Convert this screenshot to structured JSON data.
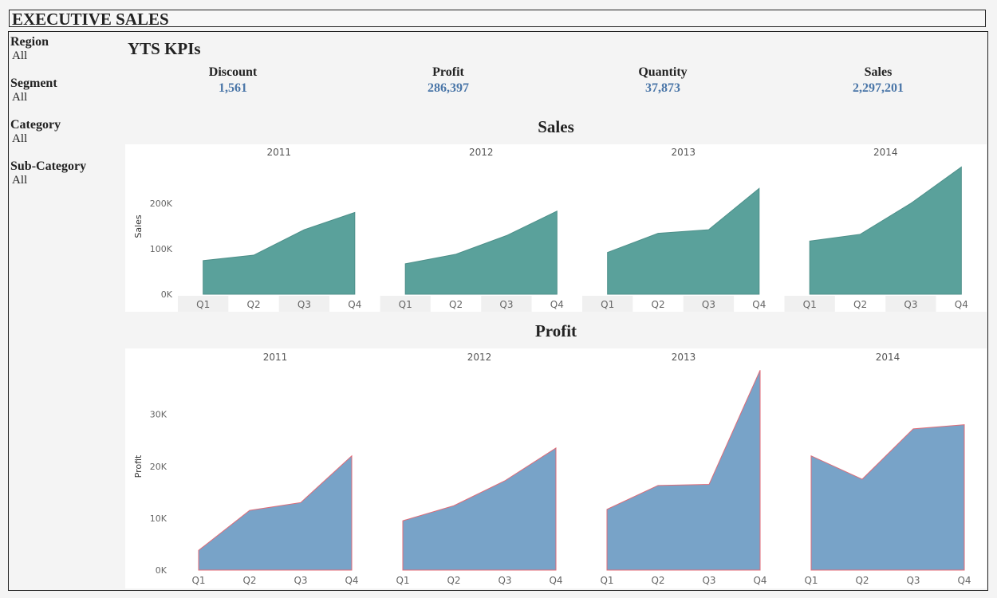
{
  "header": {
    "title": "EXECUTIVE SALES"
  },
  "filters": [
    {
      "label": "Region",
      "value": "All"
    },
    {
      "label": "Segment",
      "value": "All"
    },
    {
      "label": "Category",
      "value": "All"
    },
    {
      "label": "Sub-Category",
      "value": "All"
    }
  ],
  "kpis": {
    "title": "YTS KPIs",
    "items": [
      {
        "label": "Discount",
        "value": "1,561"
      },
      {
        "label": "Profit",
        "value": "286,397"
      },
      {
        "label": "Quantity",
        "value": "37,873"
      },
      {
        "label": "Sales",
        "value": "2,297,201"
      }
    ]
  },
  "colors": {
    "kpi_value": "#4a76a8",
    "sales_fill": "#5aa19b",
    "profit_fill": "#78a3c8",
    "profit_stroke": "#e06b77"
  },
  "chart_data": [
    {
      "type": "area",
      "title": "Sales",
      "ylabel": "Sales",
      "xlabel": "",
      "ylim": [
        0,
        230000
      ],
      "yticks": [
        0,
        100000,
        200000
      ],
      "ytick_labels": [
        "0K",
        "100K",
        "200K"
      ],
      "panels": [
        "2011",
        "2012",
        "2013",
        "2014"
      ],
      "x": [
        "Q1",
        "Q2",
        "Q3",
        "Q4"
      ],
      "values": [
        [
          74000,
          86000,
          142000,
          180000
        ],
        [
          67000,
          88000,
          129000,
          183000
        ],
        [
          92000,
          134000,
          142000,
          233000
        ],
        [
          117000,
          132000,
          200000,
          280000
        ]
      ],
      "fill": "#5aa19b",
      "stroke": "#4d8f89"
    },
    {
      "type": "area",
      "title": "Profit",
      "ylabel": "Profit",
      "xlabel": "",
      "ylim": [
        0,
        40000
      ],
      "yticks": [
        0,
        10000,
        20000,
        30000
      ],
      "ytick_labels": [
        "0K",
        "10K",
        "20K",
        "30K"
      ],
      "panels": [
        "2011",
        "2012",
        "2013",
        "2014"
      ],
      "x": [
        "Q1",
        "Q2",
        "Q3",
        "Q4"
      ],
      "values": [
        [
          3800,
          11500,
          13000,
          22000
        ],
        [
          9500,
          12400,
          17200,
          23500
        ],
        [
          11700,
          16300,
          16500,
          38500
        ],
        [
          22000,
          17500,
          27200,
          28000
        ]
      ],
      "fill": "#78a3c8",
      "stroke": "#e06b77"
    }
  ]
}
